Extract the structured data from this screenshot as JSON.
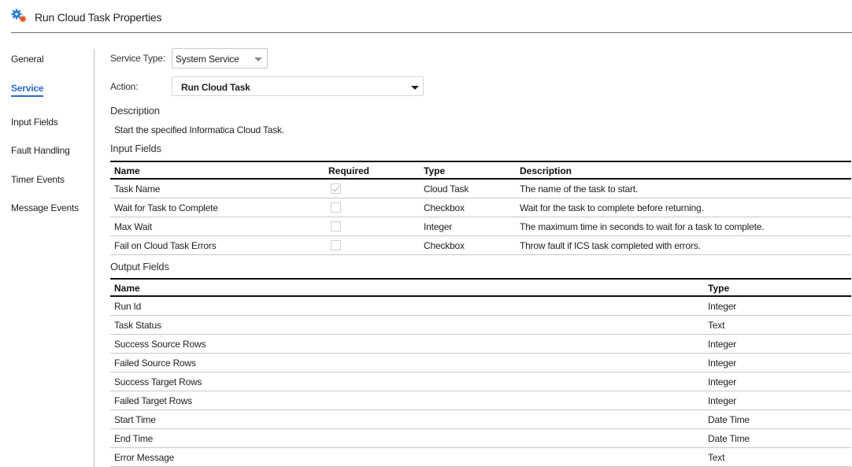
{
  "header": {
    "title": "Run Cloud Task Properties",
    "icon": "gears-icon",
    "icon_colors": {
      "primary": "#2a7bd8",
      "secondary": "#e8521e"
    }
  },
  "sidebar": {
    "items": [
      {
        "label": "General",
        "active": false
      },
      {
        "label": "Service",
        "active": true
      },
      {
        "label": "Input Fields",
        "active": false
      },
      {
        "label": "Fault Handling",
        "active": false
      },
      {
        "label": "Timer Events",
        "active": false
      },
      {
        "label": "Message Events",
        "active": false
      }
    ],
    "accent_color": "#2a6ccc"
  },
  "form": {
    "service_type_label": "Service Type:",
    "service_type_value": "System Service",
    "action_label": "Action:",
    "action_value": "Run Cloud Task",
    "description_label": "Description",
    "description_text": "Start the specified Informatica Cloud Task."
  },
  "input_fields": {
    "title": "Input Fields",
    "columns": [
      "Name",
      "Required",
      "Type",
      "Description"
    ],
    "rows": [
      {
        "name": "Task Name",
        "required": true,
        "type": "Cloud Task",
        "description": "The name of the task to start."
      },
      {
        "name": "Wait for Task to Complete",
        "required": false,
        "type": "Checkbox",
        "description": "Wait for the task to complete before returning."
      },
      {
        "name": "Max Wait",
        "required": false,
        "type": "Integer",
        "description": "The maximum time in seconds to wait for a task to complete."
      },
      {
        "name": "Fail on Cloud Task Errors",
        "required": false,
        "type": "Checkbox",
        "description": "Throw fault if ICS task completed with errors."
      }
    ]
  },
  "output_fields": {
    "title": "Output Fields",
    "columns": [
      "Name",
      "Type"
    ],
    "rows": [
      {
        "name": "Run Id",
        "type": "Integer"
      },
      {
        "name": "Task Status",
        "type": "Text"
      },
      {
        "name": "Success Source Rows",
        "type": "Integer"
      },
      {
        "name": "Failed Source Rows",
        "type": "Integer"
      },
      {
        "name": "Success Target Rows",
        "type": "Integer"
      },
      {
        "name": "Failed Target Rows",
        "type": "Integer"
      },
      {
        "name": "Start Time",
        "type": "Date Time"
      },
      {
        "name": "End Time",
        "type": "Date Time"
      },
      {
        "name": "Error Message",
        "type": "Text"
      }
    ]
  }
}
